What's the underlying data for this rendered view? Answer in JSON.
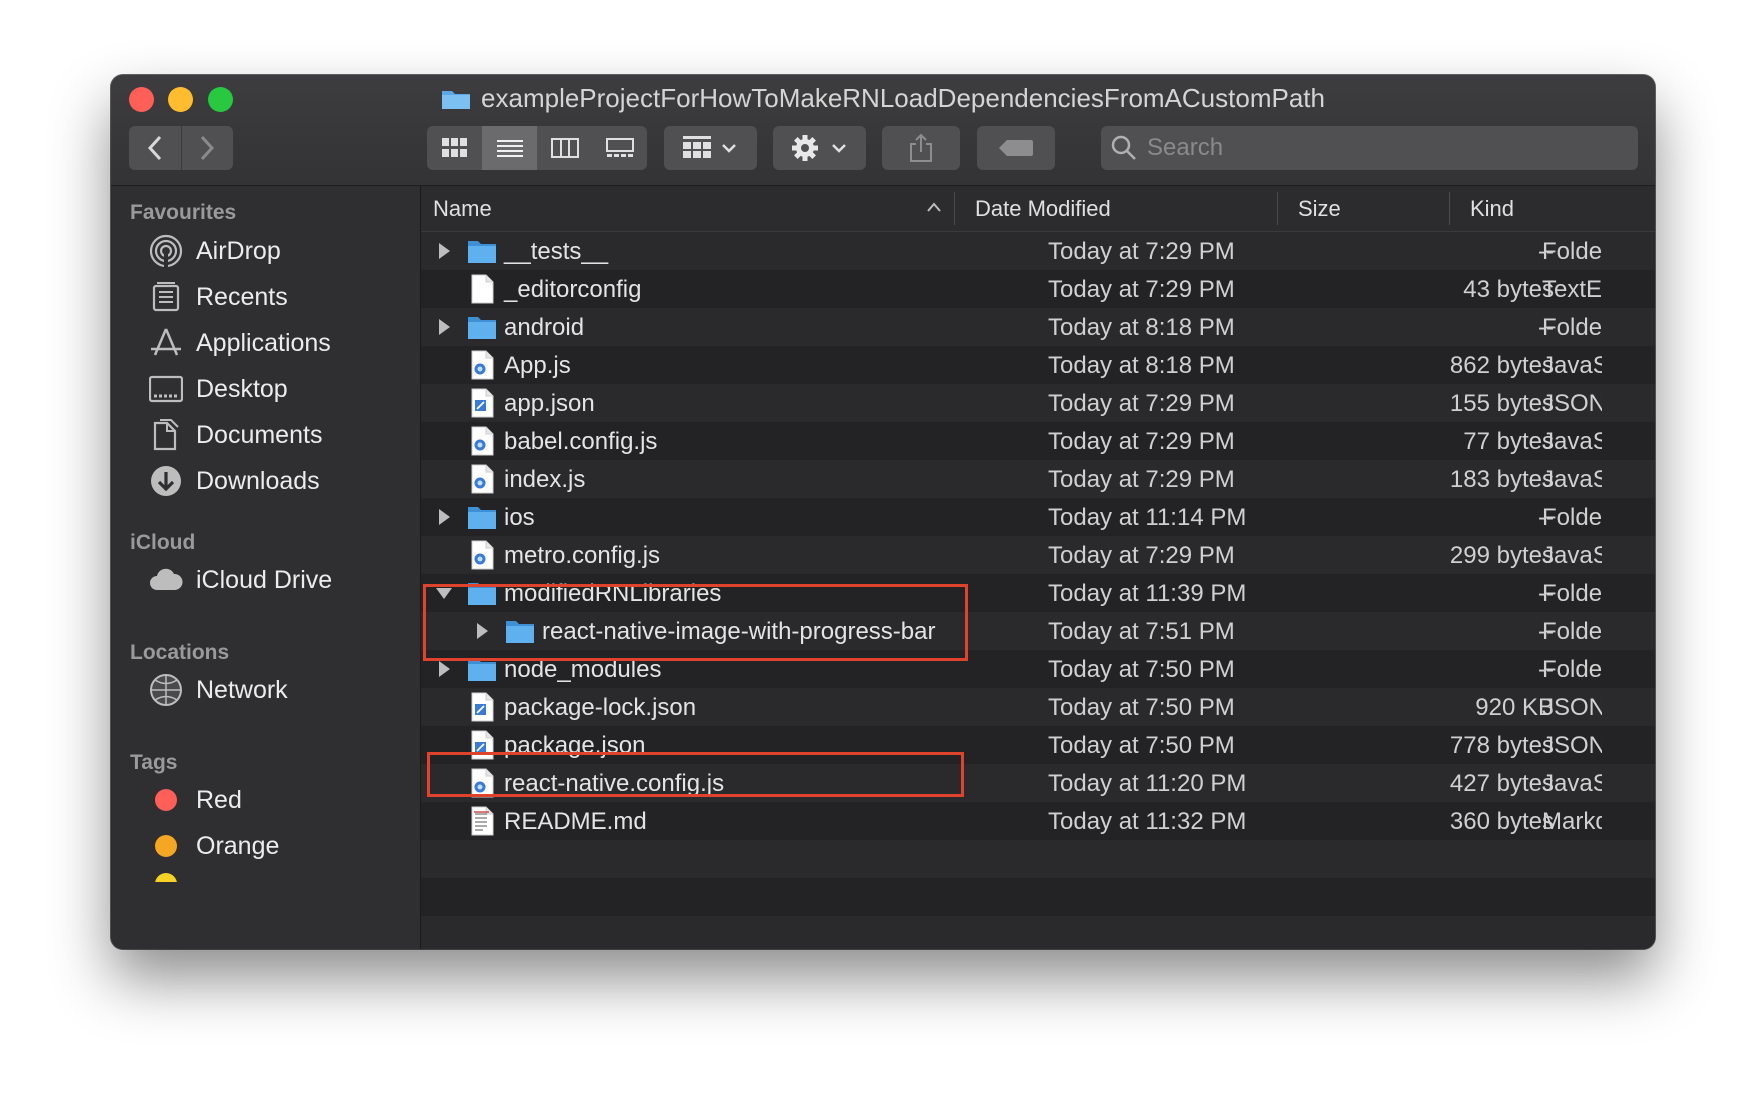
{
  "window": {
    "title": "exampleProjectForHowToMakeRNLoadDependenciesFromACustomPath"
  },
  "toolbar": {
    "back_icon": "chevron-left-icon",
    "forward_icon": "chevron-right-icon",
    "view_modes": [
      "icon-view",
      "list-view",
      "column-view",
      "gallery-view"
    ],
    "active_view": "list-view",
    "search_placeholder": "Search"
  },
  "sidebar": {
    "favourites_label": "Favourites",
    "favourites": [
      {
        "label": "AirDrop",
        "icon": "airdrop-icon"
      },
      {
        "label": "Recents",
        "icon": "recents-icon"
      },
      {
        "label": "Applications",
        "icon": "applications-icon"
      },
      {
        "label": "Desktop",
        "icon": "desktop-icon"
      },
      {
        "label": "Documents",
        "icon": "documents-icon"
      },
      {
        "label": "Downloads",
        "icon": "downloads-icon"
      }
    ],
    "icloud_label": "iCloud",
    "icloud": [
      {
        "label": "iCloud Drive",
        "icon": "icloud-icon"
      }
    ],
    "locations_label": "Locations",
    "locations": [
      {
        "label": "Network",
        "icon": "network-icon"
      }
    ],
    "tags_label": "Tags",
    "tags": [
      {
        "label": "Red",
        "color": "#ff5f57"
      },
      {
        "label": "Orange",
        "color": "#f5a623"
      }
    ]
  },
  "columns": {
    "name": "Name",
    "date": "Date Modified",
    "size": "Size",
    "kind": "Kind"
  },
  "files": [
    {
      "name": "__tests__",
      "date": "Today at 7:29 PM",
      "size": "--",
      "kind": "Folder",
      "type": "folder",
      "disclosure": "collapsed"
    },
    {
      "name": "_editorconfig",
      "date": "Today at 7:29 PM",
      "size": "43 bytes",
      "kind": "TextEdit",
      "type": "file"
    },
    {
      "name": "android",
      "date": "Today at 8:18 PM",
      "size": "--",
      "kind": "Folder",
      "type": "folder",
      "disclosure": "collapsed"
    },
    {
      "name": "App.js",
      "date": "Today at 8:18 PM",
      "size": "862 bytes",
      "kind": "JavaScript",
      "type": "js"
    },
    {
      "name": "app.json",
      "date": "Today at 7:29 PM",
      "size": "155 bytes",
      "kind": "JSON",
      "type": "json"
    },
    {
      "name": "babel.config.js",
      "date": "Today at 7:29 PM",
      "size": "77 bytes",
      "kind": "JavaScript",
      "type": "js"
    },
    {
      "name": "index.js",
      "date": "Today at 7:29 PM",
      "size": "183 bytes",
      "kind": "JavaScript",
      "type": "js"
    },
    {
      "name": "ios",
      "date": "Today at 11:14 PM",
      "size": "--",
      "kind": "Folder",
      "type": "folder",
      "disclosure": "collapsed"
    },
    {
      "name": "metro.config.js",
      "date": "Today at 7:29 PM",
      "size": "299 bytes",
      "kind": "JavaScript",
      "type": "js"
    },
    {
      "name": "modifiedRNLibraries",
      "date": "Today at 11:39 PM",
      "size": "--",
      "kind": "Folder",
      "type": "folder",
      "disclosure": "expanded"
    },
    {
      "name": "react-native-image-with-progress-bar",
      "date": "Today at 7:51 PM",
      "size": "--",
      "kind": "Folder",
      "type": "folder",
      "disclosure": "collapsed",
      "indent": 1
    },
    {
      "name": "node_modules",
      "date": "Today at 7:50 PM",
      "size": "--",
      "kind": "Folder",
      "type": "folder",
      "disclosure": "collapsed"
    },
    {
      "name": "package-lock.json",
      "date": "Today at 7:50 PM",
      "size": "920 KB",
      "kind": "JSON",
      "type": "json"
    },
    {
      "name": "package.json",
      "date": "Today at 7:50 PM",
      "size": "778 bytes",
      "kind": "JSON",
      "type": "json"
    },
    {
      "name": "react-native.config.js",
      "date": "Today at 11:20 PM",
      "size": "427 bytes",
      "kind": "JavaScript",
      "type": "js"
    },
    {
      "name": "README.md",
      "date": "Today at 11:32 PM",
      "size": "360 bytes",
      "kind": "Markdown",
      "type": "md"
    }
  ]
}
